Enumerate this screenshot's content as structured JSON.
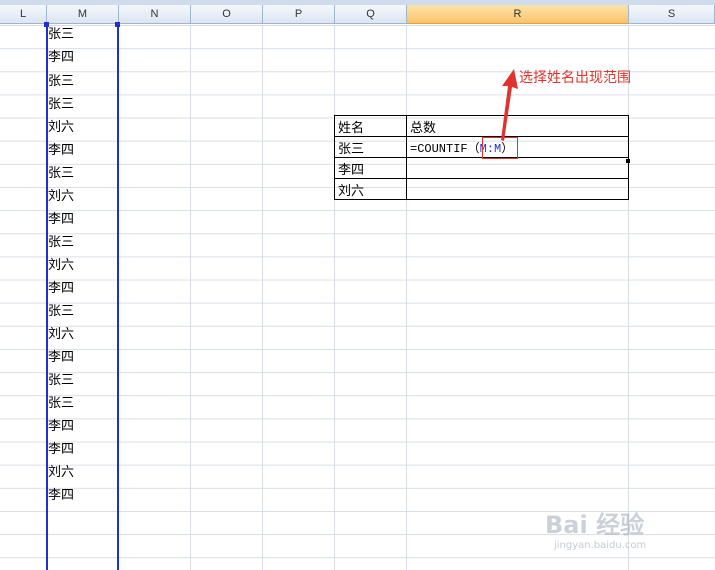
{
  "columns": [
    "L",
    "M",
    "N",
    "O",
    "P",
    "Q",
    "R",
    "S"
  ],
  "names": [
    "张三",
    "李四",
    "张三",
    "张三",
    "刘六",
    "李四",
    "张三",
    "刘六",
    "李四",
    "张三",
    "刘六",
    "李四",
    "张三",
    "刘六",
    "李四",
    "张三",
    "张三",
    "李四",
    "李四",
    "刘六",
    "李四"
  ],
  "table": {
    "header": [
      "姓名",
      "总数"
    ],
    "rows": [
      {
        "name": "张三",
        "formula_prefix": "=COUNTIF（",
        "formula_ref": "M:M",
        "formula_suffix": "）"
      },
      {
        "name": "李四",
        "value": ""
      },
      {
        "name": "刘六",
        "value": ""
      }
    ]
  },
  "annotation": "选择姓名出现范围",
  "watermark": "Bai 经验",
  "watermark_sub": "jingyan.baidu.com",
  "colors": {
    "range_blue": "#1f2fd6",
    "annotation_red": "#e0332e",
    "active_header": "#f9c46b"
  }
}
